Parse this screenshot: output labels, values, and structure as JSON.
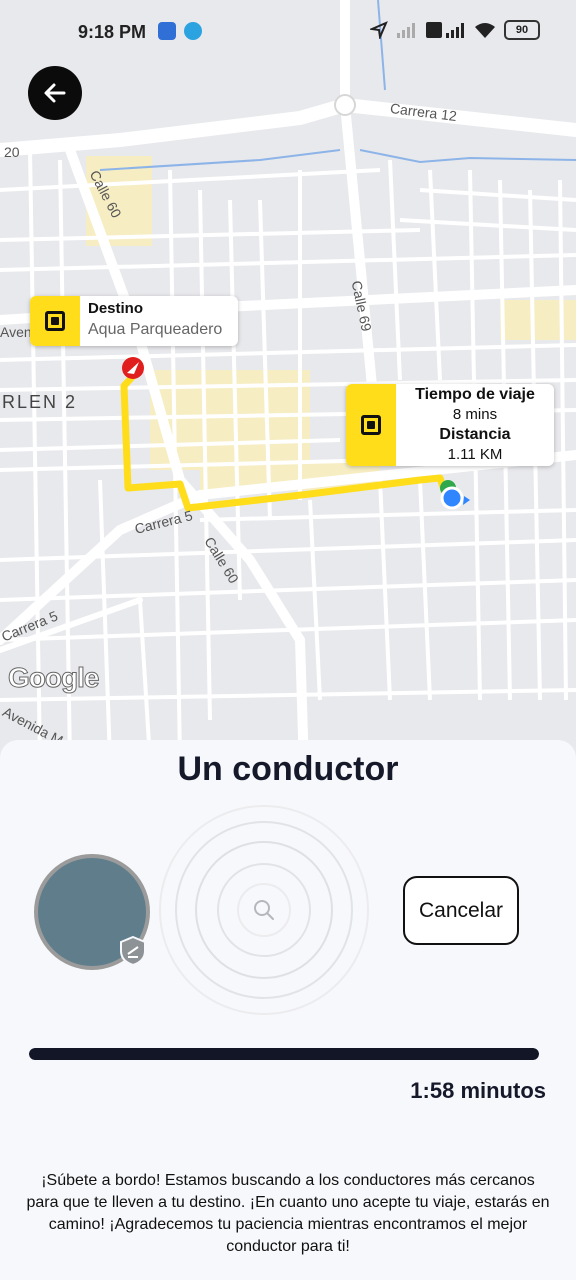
{
  "status_bar": {
    "time": "9:18 PM",
    "battery": "90",
    "icons": [
      "alarm-icon",
      "telegram-icon",
      "location-arrow-icon",
      "signal-icon",
      "volte-icon",
      "wifi-icon",
      "battery-icon"
    ]
  },
  "map": {
    "street_labels": [
      "Carrera 12",
      "20",
      "Calle 60",
      "Calle 69",
      "Avenida",
      "RLEN 2",
      "Carrera 5",
      "Calle 60",
      "Carrera 5",
      "Avenida M"
    ],
    "google_logo": "Google",
    "destination_card": {
      "title": "Destino",
      "subtitle": "Aqua Parqueadero"
    },
    "trip_card": {
      "time_label": "Tiempo de viaje",
      "time_value": "8 mins",
      "distance_label": "Distancia",
      "distance_value": "1.11 KM"
    },
    "colors": {
      "route": "#ffdd1a",
      "pin": "#e11e1e",
      "origin": "#2f86ff"
    }
  },
  "sheet": {
    "title": "Un conductor",
    "cancel_label": "Cancelar",
    "timer": "1:58 minutos",
    "progress": 1.0,
    "info": "¡Súbete a bordo! Estamos buscando a los conductores más cercanos para que te lleven a tu destino. ¡En cuanto uno acepte tu viaje, estarás en camino! ¡Agradecemos tu paciencia mientras encontramos el mejor conductor para ti!"
  }
}
